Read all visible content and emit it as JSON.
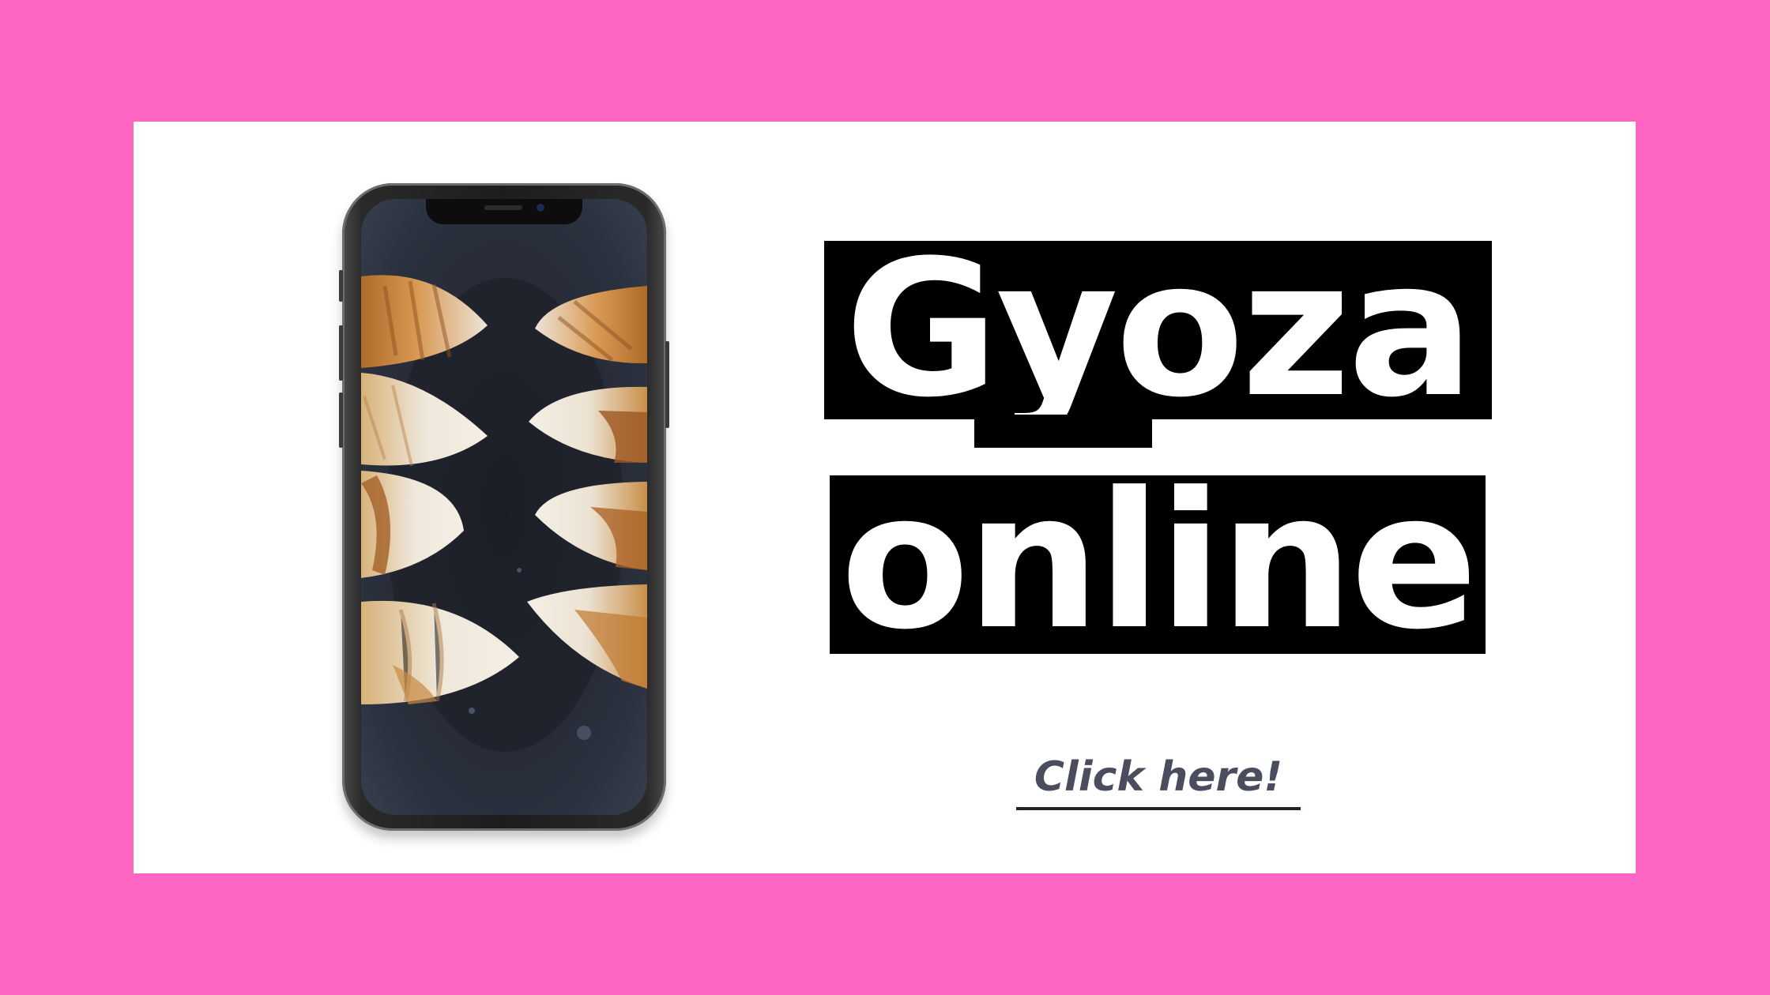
{
  "colors": {
    "background": "#ff66c4",
    "card": "#ffffff",
    "title_bg": "#000000",
    "title_text": "#ffffff",
    "cta_text": "#4a4d5e",
    "cta_underline": "#1f1f2e"
  },
  "hero": {
    "title_line_1": "Gyoza",
    "title_line_2": "online"
  },
  "cta": {
    "label": "Click here!"
  },
  "phone": {
    "icon": "smartphone-icon",
    "photo": "gyoza-dumplings-photo"
  }
}
